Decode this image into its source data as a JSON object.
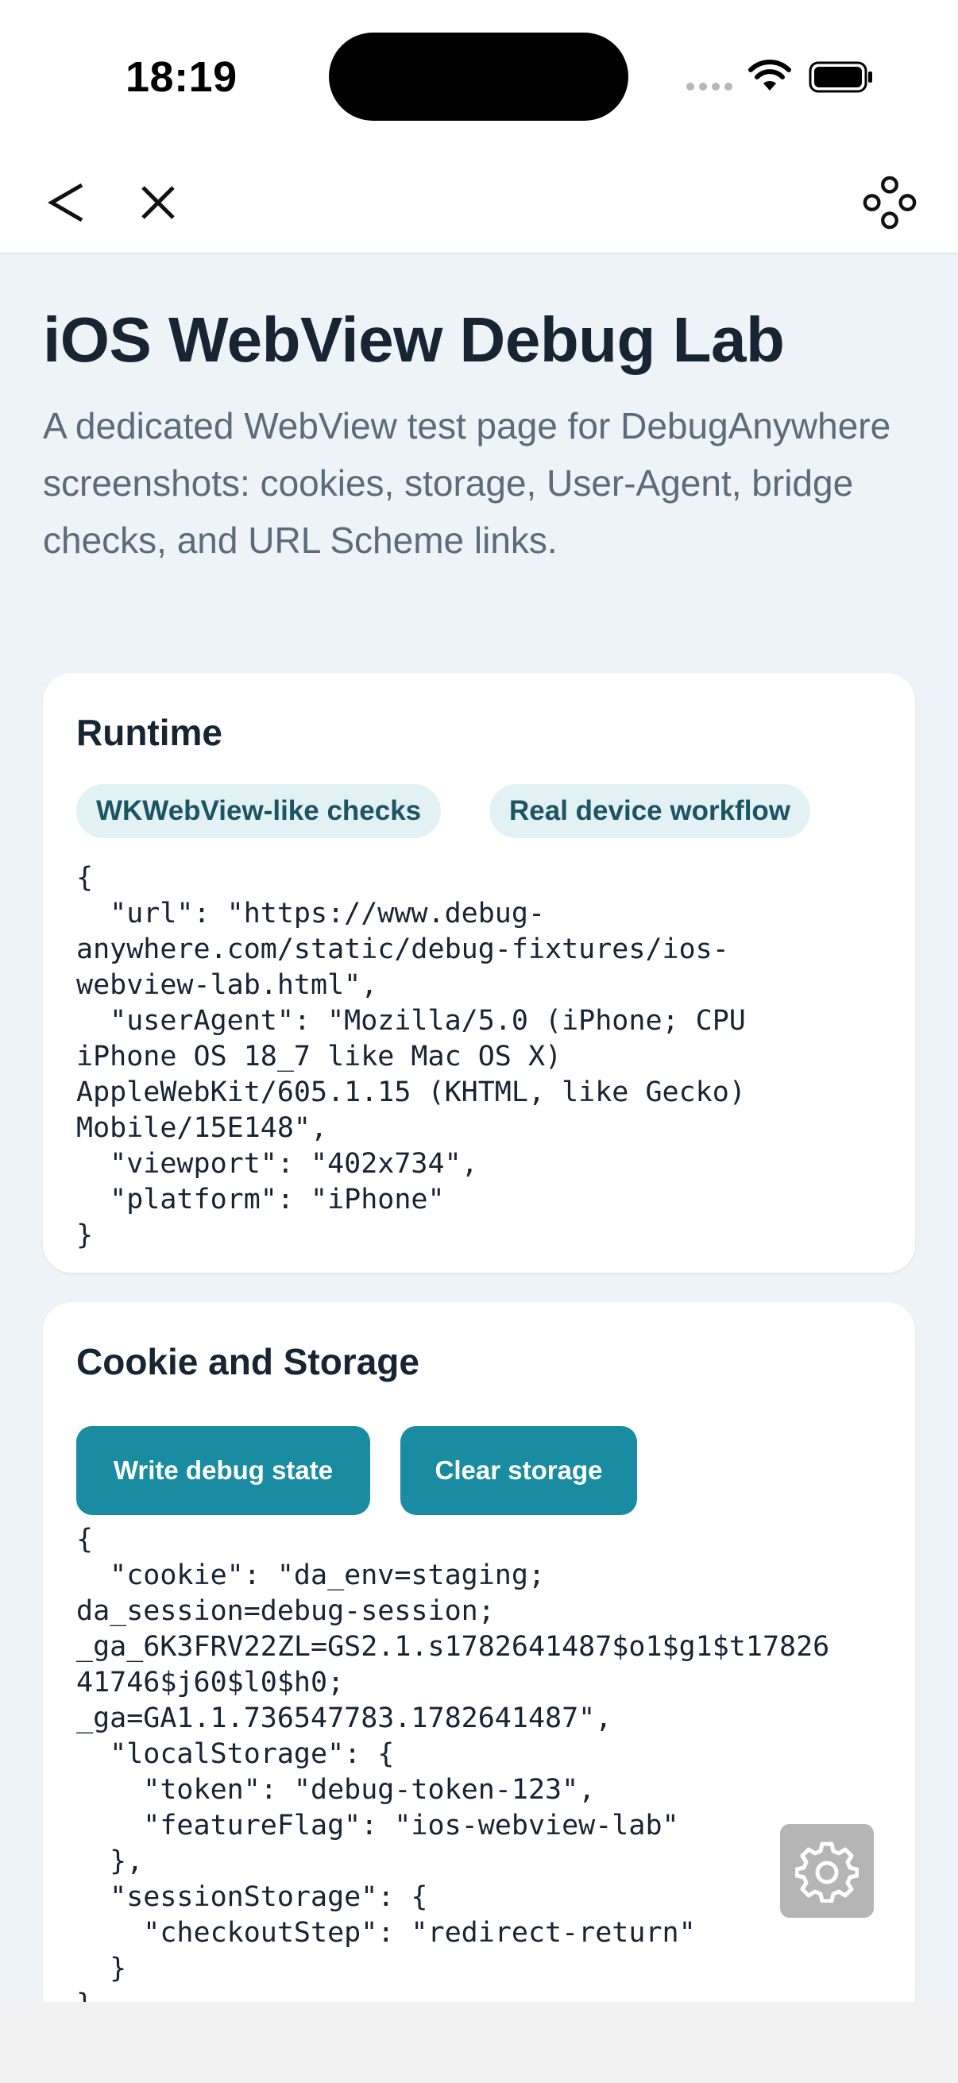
{
  "status_bar": {
    "time": "18:19"
  },
  "nav": {
    "back_icon": "chevron-left-icon",
    "close_icon": "close-icon",
    "menu_icon": "four-circles-icon"
  },
  "page": {
    "title": "iOS WebView Debug Lab",
    "description": "A dedicated WebView test page for DebugAnywhere screenshots: cookies, storage, User-Agent, bridge checks, and URL Scheme links."
  },
  "runtime": {
    "title": "Runtime",
    "chips": [
      "WKWebView-like checks",
      "Real device workflow"
    ],
    "json": "{\n  \"url\": \"https://www.debug-\nanywhere.com/static/debug-fixtures/ios-\nwebview-lab.html\",\n  \"userAgent\": \"Mozilla/5.0 (iPhone; CPU\niPhone OS 18_7 like Mac OS X)\nAppleWebKit/605.1.15 (KHTML, like Gecko)\nMobile/15E148\",\n  \"viewport\": \"402x734\",\n  \"platform\": \"iPhone\"\n}"
  },
  "storage": {
    "title": "Cookie and Storage",
    "write_button": "Write debug state",
    "clear_button": "Clear storage",
    "json": "{\n  \"cookie\": \"da_env=staging;\nda_session=debug-session;\n_ga_6K3FRV22ZL=GS2.1.s1782641487$o1$g1$t17826\n41746$j60$l0$h0;\n_ga=GA1.1.736547783.1782641487\",\n  \"localStorage\": {\n    \"token\": \"debug-token-123\",\n    \"featureFlag\": \"ios-webview-lab\"\n  },\n  \"sessionStorage\": {\n    \"checkoutStep\": \"redirect-return\"\n  }\n}"
  },
  "floating": {
    "icon": "gear-icon"
  },
  "colors": {
    "accent": "#1a8ca1",
    "chip_bg": "#e2f1f4",
    "chip_text": "#1c5466",
    "page_bg": "#eef3f7"
  }
}
